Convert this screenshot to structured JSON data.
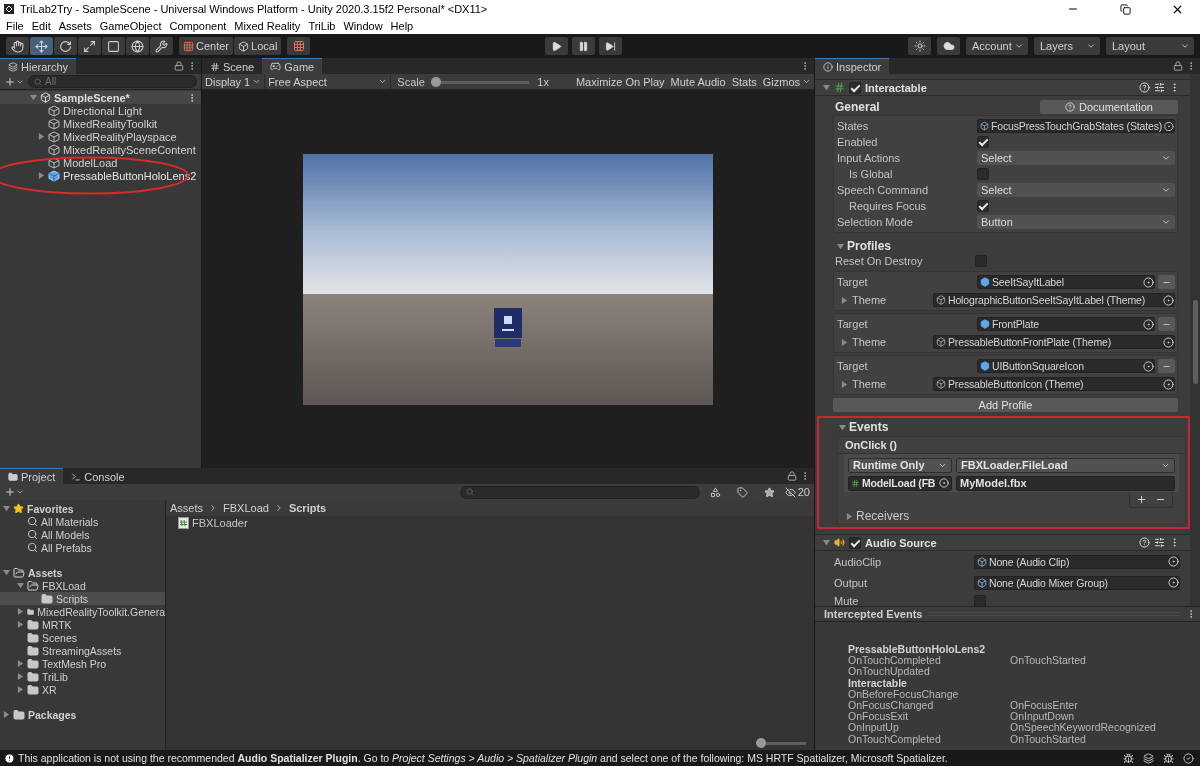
{
  "window": {
    "title": "TriLab2Try - SampleScene - Universal Windows Platform - Unity 2020.3.15f2 Personal* <DX11>"
  },
  "menu": [
    "File",
    "Edit",
    "Assets",
    "GameObject",
    "Component",
    "Mixed Reality",
    "TriLib",
    "Window",
    "Help"
  ],
  "toolbar": {
    "tools": [
      {
        "kind": "hand",
        "selected": false
      },
      {
        "kind": "move",
        "selected": true
      },
      {
        "kind": "rotate",
        "selected": false
      },
      {
        "kind": "scale",
        "selected": false
      },
      {
        "kind": "rect",
        "selected": false
      },
      {
        "kind": "transform",
        "selected": false
      },
      {
        "kind": "custom",
        "selected": false
      }
    ],
    "pivot": "Center",
    "space": "Local",
    "account": "Account",
    "layers": "Layers",
    "layout": "Layout"
  },
  "hierarchy": {
    "title": "Hierarchy",
    "search_placeholder": "All",
    "scene": "SampleScene*",
    "items": [
      {
        "label": "Directional Light",
        "kind": "object",
        "has_children": false,
        "circled": false
      },
      {
        "label": "MixedRealityToolkit",
        "kind": "object",
        "has_children": false,
        "circled": false
      },
      {
        "label": "MixedRealityPlayspace",
        "kind": "object",
        "has_children": true,
        "expanded": false,
        "circled": false
      },
      {
        "label": "MixedRealitySceneContent",
        "kind": "object",
        "has_children": false,
        "circled": false
      },
      {
        "label": "ModelLoad",
        "kind": "object",
        "has_children": false,
        "circled": false
      },
      {
        "label": "PressableButtonHoloLens2",
        "kind": "prefab",
        "has_children": true,
        "expanded": false,
        "circled": true
      }
    ]
  },
  "game": {
    "tabs": [
      {
        "label": "Scene",
        "kind": "scene",
        "selected": false
      },
      {
        "label": "Game",
        "kind": "game",
        "selected": true
      }
    ],
    "display": "Display 1",
    "aspect": "Free Aspect",
    "scale_label": "Scale",
    "scale": {
      "level": 0
    },
    "scale_reading": "1x",
    "buttons": [
      {
        "label": "Maximize On Play",
        "dropdown": false
      },
      {
        "label": "Mute Audio",
        "dropdown": false
      },
      {
        "label": "Stats",
        "dropdown": false
      },
      {
        "label": "Gizmos",
        "dropdown": true
      }
    ]
  },
  "inspector": {
    "tab": "Inspector",
    "interactable": {
      "name": "Interactable",
      "enabled": true,
      "documentation": "Documentation",
      "general_title": "General",
      "fields": [
        {
          "label": "States",
          "kind": "object",
          "value": "FocusPressTouchGrabStates (States)",
          "indent": false
        },
        {
          "label": "Enabled",
          "kind": "checkbox",
          "checked": true,
          "indent": false
        },
        {
          "label": "Input Actions",
          "kind": "dropdown",
          "value": "Select",
          "indent": false
        },
        {
          "label": "Is Global",
          "kind": "checkbox",
          "checked": false,
          "indent": true
        },
        {
          "label": "Speech Command",
          "kind": "dropdown",
          "value": "Select",
          "indent": false
        },
        {
          "label": "Requires Focus",
          "kind": "checkbox",
          "checked": true,
          "indent": true
        },
        {
          "label": "Selection Mode",
          "kind": "dropdown",
          "value": "Button",
          "indent": false
        }
      ],
      "profiles_title": "Profiles",
      "reset_label": "Reset On Destroy",
      "reset_checked": false,
      "profiles": [
        {
          "target_label": "Target",
          "target": "SeeItSayItLabel",
          "theme_label": "Theme",
          "theme": "HolographicButtonSeeItSayItLabel (Theme)"
        },
        {
          "target_label": "Target",
          "target": "FrontPlate",
          "theme_label": "Theme",
          "theme": "PressableButtonFrontPlate (Theme)"
        },
        {
          "target_label": "Target",
          "target": "UIButtonSquareIcon",
          "theme_label": "Theme",
          "theme": "PressableButtonIcon (Theme)"
        }
      ],
      "add_profile": "Add Profile"
    },
    "events": {
      "title": "Events",
      "highlighted": true,
      "event": "OnClick ()",
      "runtime": "Runtime Only",
      "function": "FBXLoader.FileLoad",
      "object": "ModelLoad (FB",
      "argument": "MyModel.fbx",
      "receivers": "Receivers"
    },
    "audio": {
      "name": "Audio Source",
      "enabled": true,
      "fields": [
        {
          "label": "AudioClip",
          "kind": "object",
          "value": "None (Audio Clip)"
        },
        {
          "label": "Output",
          "kind": "object",
          "value": "None (Audio Mixer Group)"
        },
        {
          "label": "Mute",
          "kind": "checkbox",
          "checked": false
        }
      ]
    },
    "intercepted": {
      "title": "Intercepted Events",
      "groups": [
        {
          "title": "PressableButtonHoloLens2",
          "rows": [
            [
              "OnTouchCompleted",
              "OnTouchStarted"
            ],
            [
              "OnTouchUpdated"
            ]
          ]
        },
        {
          "title": "Interactable",
          "rows": [
            [
              "OnBeforeFocusChange"
            ],
            [
              "OnFocusChanged",
              "OnFocusEnter"
            ],
            [
              "OnFocusExit",
              "OnInputDown"
            ],
            [
              "OnInputUp",
              "OnSpeechKeywordRecognized"
            ],
            [
              "OnTouchCompleted",
              "OnTouchStarted"
            ]
          ]
        }
      ]
    }
  },
  "project": {
    "tabs": [
      {
        "label": "Project",
        "kind": "project",
        "selected": true
      },
      {
        "label": "Console",
        "kind": "console",
        "selected": false
      }
    ],
    "hidden_count": "20",
    "tree": [
      {
        "label": "Favorites",
        "kind": "favorites",
        "has_children": true,
        "expanded": true,
        "selected": false,
        "children": [
          {
            "label": "All Materials",
            "kind": "search",
            "has_children": false,
            "selected": false
          },
          {
            "label": "All Models",
            "kind": "search",
            "has_children": false,
            "selected": false
          },
          {
            "label": "All Prefabs",
            "kind": "search",
            "has_children": false,
            "selected": false
          }
        ]
      },
      {
        "label": "Assets",
        "kind": "folder",
        "has_children": true,
        "expanded": true,
        "selected": false,
        "children": [
          {
            "label": "FBXLoad",
            "kind": "folder",
            "has_children": true,
            "expanded": true,
            "selected": false,
            "children": [
              {
                "label": "Scripts",
                "kind": "folder",
                "has_children": false,
                "selected": true
              }
            ]
          },
          {
            "label": "MixedRealityToolkit.Genera",
            "kind": "folder",
            "has_children": true,
            "expanded": false,
            "selected": false
          },
          {
            "label": "MRTK",
            "kind": "folder",
            "has_children": true,
            "expanded": false,
            "selected": false
          },
          {
            "label": "Scenes",
            "kind": "folder",
            "has_children": false,
            "selected": false
          },
          {
            "label": "StreamingAssets",
            "kind": "folder",
            "has_children": false,
            "selected": false
          },
          {
            "label": "TextMesh Pro",
            "kind": "folder",
            "has_children": true,
            "expanded": false,
            "selected": false
          },
          {
            "label": "TriLib",
            "kind": "folder",
            "has_children": true,
            "expanded": false,
            "selected": false
          },
          {
            "label": "XR",
            "kind": "folder",
            "has_children": true,
            "expanded": false,
            "selected": false
          }
        ]
      },
      {
        "label": "Packages",
        "kind": "folder",
        "has_children": true,
        "expanded": false,
        "selected": false
      }
    ],
    "breadcrumb": [
      "Assets",
      "FBXLoad",
      "Scripts"
    ],
    "files": [
      {
        "name": "FBXLoader",
        "kind": "script"
      }
    ],
    "zoom": {
      "level": 0
    }
  },
  "status": {
    "message": "This application is not using the recommended **Audio Spatializer Plugin**. Go to *Project Settings > Audio > Spatializer Plugin* and select one of the following: MS HRTF Spatializer, Microsoft Spatializer."
  }
}
